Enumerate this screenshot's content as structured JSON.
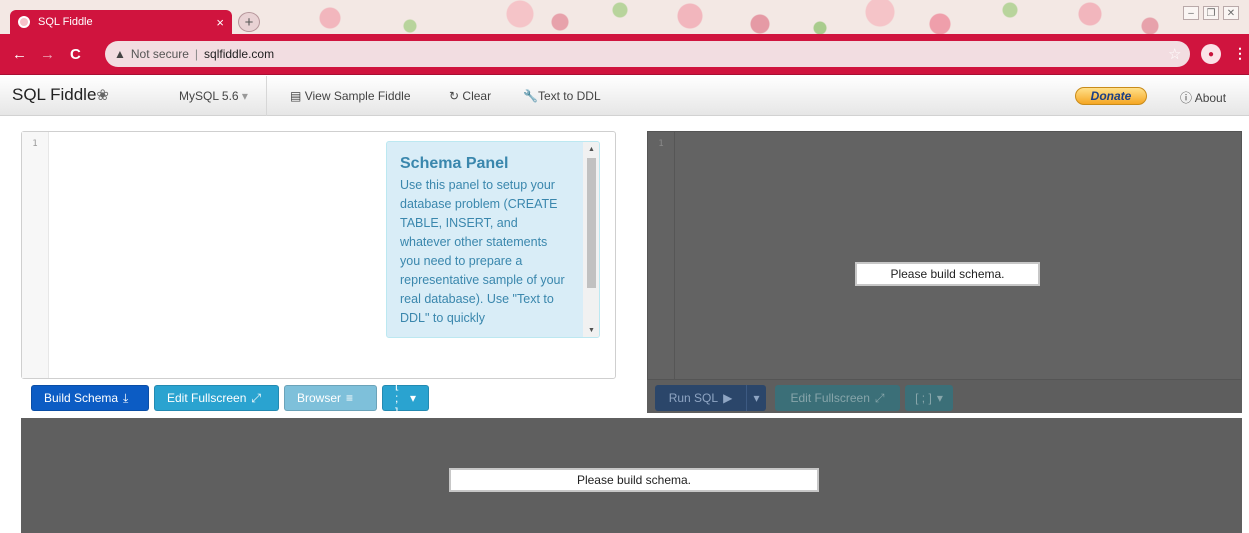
{
  "browser": {
    "tab_title": "SQL Fiddle",
    "tab_close": "×",
    "new_tab": "+",
    "not_secure": "Not secure",
    "separator": "|",
    "url": "sqlfiddle.com",
    "accent_color": "#d0143e"
  },
  "nav": {
    "brand": "SQL Fiddle",
    "db_select": "MySQL 5.6",
    "view_sample": "View Sample Fiddle",
    "clear": "Clear",
    "text_to_ddl": "Text to DDL",
    "donate": "Donate",
    "about": "About"
  },
  "schema": {
    "line_number": "1",
    "help_title": "Schema Panel",
    "help_text": "Use this panel to setup your database problem (CREATE TABLE, INSERT, and whatever other statements you need to prepare a representative sample of your real database). Use \"Text to DDL\" to quickly",
    "build_schema": "Build Schema",
    "edit_fullscreen": "Edit Fullscreen",
    "browser": "Browser",
    "terminator": "[ ; ]"
  },
  "query": {
    "line_number": "1",
    "message": "Please build schema.",
    "run_sql": "Run SQL",
    "edit_fullscreen": "Edit Fullscreen",
    "terminator": "[ ; ]"
  },
  "results": {
    "message": "Please build schema."
  }
}
